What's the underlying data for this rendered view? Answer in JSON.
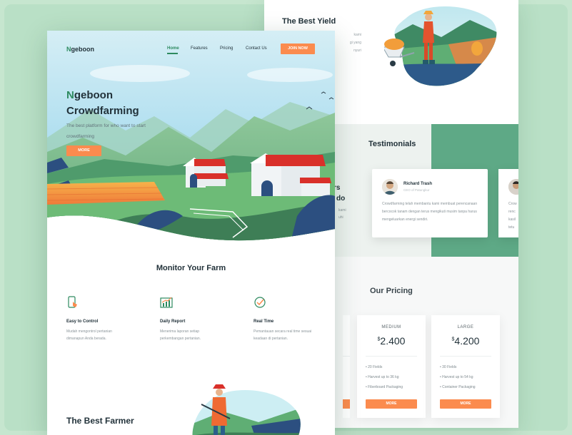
{
  "back": {
    "yield_title": "The Best Yield",
    "yield_lines": [
      "kami",
      "gi yang",
      "nyuri"
    ],
    "testimonials_title": "Testimonials",
    "partial_heading": [
      "rs",
      "do"
    ],
    "partial_lines": [
      "kami",
      "uhi"
    ],
    "testimonial": {
      "name": "Richard Trash",
      "role": "CEO of Patungkur",
      "quote": "Crowdfarming telah membantu kami membuat perencanaan bercocok tanam dengan terus mengikuti musim tanpa harus mengeluarkan energi sendiri."
    },
    "testimonial2_lines": [
      "Crow",
      "renc",
      "kasil",
      "tetu"
    ],
    "pricing_title": "Our Pricing",
    "plans": [
      {
        "name": "MEDIUM",
        "currency": "$",
        "price": "2.400",
        "features": [
          "20 Fields",
          "Harvest up to 36 kg",
          "Fiberboard Packaging"
        ],
        "button": "MORE"
      },
      {
        "name": "LARGE",
        "currency": "$",
        "price": "4.200",
        "features": [
          "30 Fields",
          "Harvest up to 54 kg",
          "Container Packaging"
        ],
        "button": "MORE"
      }
    ]
  },
  "front": {
    "logo_initial": "N",
    "logo_rest": "geboon",
    "nav": [
      "Home",
      "Features",
      "Pricing",
      "Contact Us"
    ],
    "join_label": "JOIN NOW",
    "hero_title_initial": "N",
    "hero_title_rest": "geboon",
    "hero_title_line2": "Crowdfarming",
    "hero_subtitle": "The best platform for who want to start crowdfarming",
    "more_label": "MORE",
    "monitor_title": "Monitor Your Farm",
    "features": [
      {
        "icon": "phone-touch-icon",
        "title": "Easy to Control",
        "desc": "Mudah mengontrol pertanian dimanapun Anda berada."
      },
      {
        "icon": "chart-report-icon",
        "title": "Daily Report",
        "desc": "Menerima laporan setiap perkembangan pertanian."
      },
      {
        "icon": "clock-check-icon",
        "title": "Real Time",
        "desc": "Pemantauan secara real time sesuai keadaan di pertanian."
      }
    ],
    "farmer_title": "The Best Farmer"
  },
  "colors": {
    "accent_orange": "#fb8b4e",
    "brand_green": "#2d8a5f",
    "background_mint": "#c6e6cf",
    "testimonial_green": "#5ea986"
  }
}
